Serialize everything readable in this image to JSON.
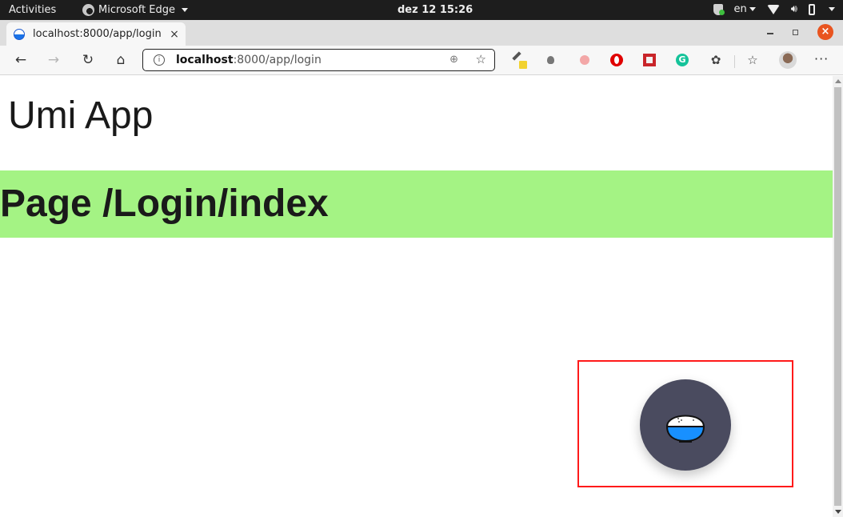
{
  "system_bar": {
    "activities_label": "Activities",
    "app_name": "Microsoft Edge",
    "clock": "dez 12  15:26",
    "language": "en"
  },
  "browser": {
    "tab": {
      "title": "localhost:8000/app/login",
      "close_glyph": "×"
    },
    "new_tab_glyph": "+",
    "window_controls": {
      "close_glyph": "×"
    },
    "nav": {
      "back_glyph": "←",
      "forward_glyph": "→",
      "reload_glyph": "↻",
      "home_glyph": "⌂"
    },
    "address_bar": {
      "host": "localhost",
      "path": ":8000/app/login",
      "info_glyph": "i"
    },
    "toolbar_icons": {
      "zoom_glyph": "⊕",
      "favorite_glyph": "☆",
      "extensions_glyph": "✿",
      "favorites_glyph": "☆",
      "more_glyph": "···"
    }
  },
  "page": {
    "app_title": "Umi App",
    "page_heading": "Page /Login/index",
    "banner_color": "#a4f384",
    "highlight_border_color": "#ff1a1a",
    "fab": {
      "icon": "rice-bowl-icon",
      "background_color": "#4a4b5f"
    }
  }
}
